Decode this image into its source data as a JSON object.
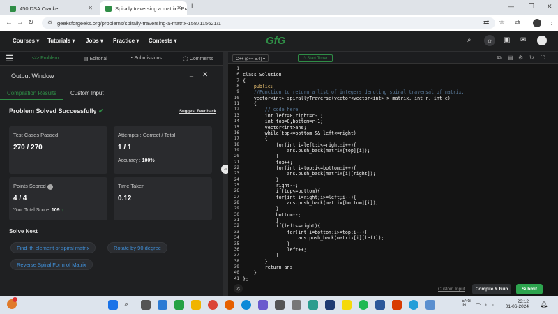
{
  "browser": {
    "tabs": [
      {
        "title": "450 DSA Cracker",
        "active": false
      },
      {
        "title": "Spirally traversing a matrix | Pra",
        "active": true
      }
    ],
    "url": "geeksforgeeks.org/problems/spirally-traversing-a-matrix-1587115621/1"
  },
  "nav": {
    "items": [
      "Courses",
      "Tutorials",
      "Jobs",
      "Practice",
      "Contests"
    ],
    "logo": "GfG"
  },
  "problem_tabs": [
    "Problem",
    "Editorial",
    "Submissions",
    "Comments"
  ],
  "output": {
    "window_title": "Output Window",
    "tabs": [
      "Compilation Results",
      "Custom Input"
    ],
    "status": "Problem Solved Successfully",
    "suggest": "Suggest Feedback",
    "cards": {
      "test_label": "Test Cases Passed",
      "test_value": "270 / 270",
      "attempts_label": "Attempts : Correct / Total",
      "attempts_value": "1 / 1",
      "accuracy_label": "Accuracy :",
      "accuracy_value": "100%",
      "points_label": "Points Scored",
      "points_value": "4 / 4",
      "total_label": "Your Total Score:",
      "total_value": "109",
      "time_label": "Time Taken",
      "time_value": "0.12"
    },
    "solve_next_title": "Solve Next",
    "solve_next": [
      "Find ith element of spiral matrix",
      "Rotate by 90 degree",
      "Reverse Spiral Form of Matrix"
    ]
  },
  "editor": {
    "language": "C++ (g++ 5.4)",
    "timer": "Start Timer",
    "lines": [
      {
        "n": "1",
        "t": ""
      },
      {
        "n": "6",
        "t": "class Solution"
      },
      {
        "n": "7",
        "t": "{"
      },
      {
        "n": "8",
        "t": "    public:"
      },
      {
        "n": "9",
        "t": "    //Function to return a list of integers denoting spiral traversal of matrix."
      },
      {
        "n": "10",
        "t": "    vector<int> spirallyTraverse(vector<vector<int> > matrix, int r, int c)"
      },
      {
        "n": "11",
        "t": "    {"
      },
      {
        "n": "12",
        "t": "        // code here"
      },
      {
        "n": "13",
        "t": "        int left=0,right=c-1;"
      },
      {
        "n": "14",
        "t": "        int top=0,bottom=r-1;"
      },
      {
        "n": "15",
        "t": "        vector<int>ans;"
      },
      {
        "n": "16",
        "t": "        while(top<=bottom && left<=right)"
      },
      {
        "n": "17",
        "t": "        {"
      },
      {
        "n": "18",
        "t": "            for(int i=left;i<=right;i++){"
      },
      {
        "n": "19",
        "t": "                ans.push_back(matrix[top][i]);"
      },
      {
        "n": "20",
        "t": "            }"
      },
      {
        "n": "21",
        "t": "            top++;"
      },
      {
        "n": "22",
        "t": "            for(int i=top;i<=bottom;i++){"
      },
      {
        "n": "23",
        "t": "                ans.push_back(matrix[i][right]);"
      },
      {
        "n": "24",
        "t": "            }"
      },
      {
        "n": "25",
        "t": "            right--;"
      },
      {
        "n": "26",
        "t": "            if(top<=bottom){"
      },
      {
        "n": "27",
        "t": "            for(int i=right;i>=left;i--){"
      },
      {
        "n": "28",
        "t": "                ans.push_back(matrix[bottom][i]);"
      },
      {
        "n": "29",
        "t": "            }"
      },
      {
        "n": "30",
        "t": "            bottom--;"
      },
      {
        "n": "31",
        "t": "            }"
      },
      {
        "n": "32",
        "t": "            if(left<=right){"
      },
      {
        "n": "33",
        "t": "                for(int i=bottom;i>=top;i--){"
      },
      {
        "n": "34",
        "t": "                    ans.push_back(matrix[i][left]);"
      },
      {
        "n": "35",
        "t": "                }"
      },
      {
        "n": "36",
        "t": "                left++;"
      },
      {
        "n": "37",
        "t": "            }"
      },
      {
        "n": "38",
        "t": "        }"
      },
      {
        "n": "39",
        "t": "        return ans;"
      },
      {
        "n": "40",
        "t": "    }"
      },
      {
        "n": "41",
        "t": "};"
      }
    ],
    "custom_input": "Custom Input",
    "compile": "Compile & Run",
    "submit": "Submit"
  },
  "taskbar": {
    "lang1": "ENG",
    "lang2": "IN",
    "time": "23:12",
    "date": "01-06-2024"
  },
  "colors": {
    "accent": "#2f8d46",
    "link": "#3f8fd8",
    "submit": "#2da44e"
  }
}
